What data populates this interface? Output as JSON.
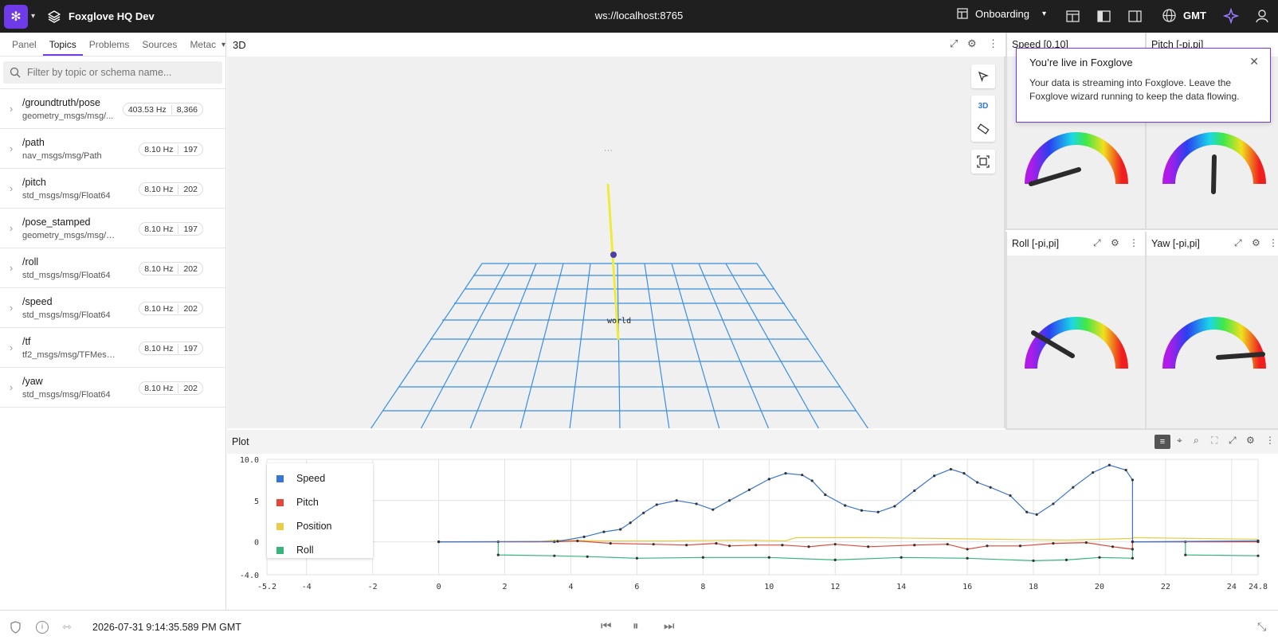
{
  "app": {
    "name": "Foxglove HQ Dev",
    "connection": "ws://localhost:8765",
    "layout": "Onboarding",
    "timezone": "GMT"
  },
  "sidebar": {
    "tabs": [
      "Panel",
      "Topics",
      "Problems",
      "Sources",
      "Metac"
    ],
    "active_tab": "Topics",
    "search_placeholder": "Filter by topic or schema name...",
    "topics": [
      {
        "name": "/groundtruth/pose",
        "schema": "geometry_msgs/msg/...",
        "hz": "403.53 Hz",
        "count": "8,366"
      },
      {
        "name": "/path",
        "schema": "nav_msgs/msg/Path",
        "hz": "8.10 Hz",
        "count": "197"
      },
      {
        "name": "/pitch",
        "schema": "std_msgs/msg/Float64",
        "hz": "8.10 Hz",
        "count": "202"
      },
      {
        "name": "/pose_stamped",
        "schema": "geometry_msgs/msg/Pose...",
        "hz": "8.10 Hz",
        "count": "197"
      },
      {
        "name": "/roll",
        "schema": "std_msgs/msg/Float64",
        "hz": "8.10 Hz",
        "count": "202"
      },
      {
        "name": "/speed",
        "schema": "std_msgs/msg/Float64",
        "hz": "8.10 Hz",
        "count": "202"
      },
      {
        "name": "/tf",
        "schema": "tf2_msgs/msg/TFMessage",
        "hz": "8.10 Hz",
        "count": "197"
      },
      {
        "name": "/yaw",
        "schema": "std_msgs/msg/Float64",
        "hz": "8.10 Hz",
        "count": "202"
      }
    ]
  },
  "panel3d": {
    "title": "3D",
    "mode_label": "3D",
    "frame_label": "world"
  },
  "toast": {
    "title": "You’re live in Foxglove",
    "body": "Your data is streaming into Foxglove. Leave the Foxglove wizard running to keep the data flowing."
  },
  "gauges": {
    "speed_title": "Speed [0,10]",
    "pitch_title": "Pitch [-pi,pi]",
    "roll_title": "Roll [-pi,pi]",
    "yaw_title": "Yaw [-pi,pi]"
  },
  "plot": {
    "title": "Plot",
    "legend": [
      {
        "name": "Speed",
        "color": "#3a75d4"
      },
      {
        "name": "Pitch",
        "color": "#e0493a"
      },
      {
        "name": "Position",
        "color": "#e8cd4a"
      },
      {
        "name": "Roll",
        "color": "#35b57b"
      }
    ]
  },
  "chart_data": {
    "type": "line",
    "xlim": [
      -5.2,
      24.8
    ],
    "ylim": [
      -4.0,
      10.0
    ],
    "x_ticks": [
      "-5.2",
      "-4",
      "-2",
      "0",
      "2",
      "4",
      "6",
      "8",
      "10",
      "12",
      "14",
      "16",
      "18",
      "20",
      "22",
      "24",
      "24.8"
    ],
    "y_ticks": [
      "10.0",
      "5",
      "0",
      "-4.0"
    ],
    "series": [
      {
        "name": "Speed",
        "points": [
          [
            0,
            0
          ],
          [
            3.6,
            0.05
          ],
          [
            4.4,
            0.6
          ],
          [
            5,
            1.2
          ],
          [
            5.5,
            1.5
          ],
          [
            5.8,
            2.3
          ],
          [
            6.2,
            3.5
          ],
          [
            6.6,
            4.5
          ],
          [
            7.2,
            5
          ],
          [
            7.8,
            4.6
          ],
          [
            8.3,
            3.9
          ],
          [
            8.8,
            5
          ],
          [
            9.4,
            6.3
          ],
          [
            10,
            7.6
          ],
          [
            10.5,
            8.3
          ],
          [
            11,
            8.1
          ],
          [
            11.3,
            7.4
          ],
          [
            11.7,
            5.7
          ],
          [
            12.3,
            4.4
          ],
          [
            12.8,
            3.8
          ],
          [
            13.3,
            3.6
          ],
          [
            13.8,
            4.3
          ],
          [
            14.4,
            6.2
          ],
          [
            15,
            8
          ],
          [
            15.5,
            8.8
          ],
          [
            15.9,
            8.3
          ],
          [
            16.3,
            7.2
          ],
          [
            16.7,
            6.6
          ],
          [
            17.3,
            5.6
          ],
          [
            17.8,
            3.6
          ],
          [
            18.1,
            3.3
          ],
          [
            18.6,
            4.6
          ],
          [
            19.2,
            6.6
          ],
          [
            19.8,
            8.4
          ],
          [
            20.3,
            9.3
          ],
          [
            20.8,
            8.7
          ],
          [
            21,
            7.5
          ],
          [
            21,
            0
          ],
          [
            24.8,
            0.1
          ]
        ]
      },
      {
        "name": "Pitch",
        "points": [
          [
            0,
            0
          ],
          [
            3.5,
            0
          ],
          [
            4.2,
            0.1
          ],
          [
            5.2,
            -0.2
          ],
          [
            6.5,
            -0.3
          ],
          [
            7.5,
            -0.4
          ],
          [
            8.4,
            -0.2
          ],
          [
            8.8,
            -0.5
          ],
          [
            9.6,
            -0.4
          ],
          [
            10.4,
            -0.4
          ],
          [
            11.2,
            -0.6
          ],
          [
            12,
            -0.3
          ],
          [
            13,
            -0.6
          ],
          [
            14.4,
            -0.4
          ],
          [
            15.4,
            -0.3
          ],
          [
            16,
            -0.9
          ],
          [
            16.6,
            -0.5
          ],
          [
            17.6,
            -0.5
          ],
          [
            18.6,
            -0.2
          ],
          [
            19.6,
            -0.1
          ],
          [
            20.4,
            -0.6
          ],
          [
            21,
            -0.9
          ],
          [
            21,
            0
          ],
          [
            24.8,
            0
          ]
        ]
      },
      {
        "name": "Position",
        "points": [
          [
            0,
            0
          ],
          [
            3,
            0
          ],
          [
            3.5,
            0.2
          ],
          [
            5,
            0.1
          ],
          [
            7,
            0.1
          ],
          [
            9,
            0.2
          ],
          [
            10.5,
            0.1
          ],
          [
            10.8,
            0.5
          ],
          [
            13,
            0.5
          ],
          [
            15,
            0.4
          ],
          [
            17,
            0.3
          ],
          [
            19,
            0.2
          ],
          [
            21,
            0.4
          ],
          [
            21,
            0.5
          ],
          [
            24.8,
            0.3
          ]
        ]
      },
      {
        "name": "Roll",
        "points": [
          [
            0,
            0
          ],
          [
            1.8,
            0
          ],
          [
            1.8,
            -1.6
          ],
          [
            3.5,
            -1.7
          ],
          [
            4.5,
            -1.8
          ],
          [
            6,
            -2
          ],
          [
            8,
            -1.9
          ],
          [
            10,
            -1.9
          ],
          [
            12,
            -2.2
          ],
          [
            14,
            -1.9
          ],
          [
            16,
            -2
          ],
          [
            18,
            -2.3
          ],
          [
            19,
            -2.2
          ],
          [
            20,
            -1.9
          ],
          [
            21,
            -2
          ],
          [
            21,
            0
          ],
          [
            22.6,
            0
          ],
          [
            22.6,
            -1.6
          ],
          [
            24.8,
            -1.7
          ]
        ]
      }
    ]
  },
  "bottom": {
    "timestamp": "2026-07-31 9:14:35.589 PM GMT"
  }
}
